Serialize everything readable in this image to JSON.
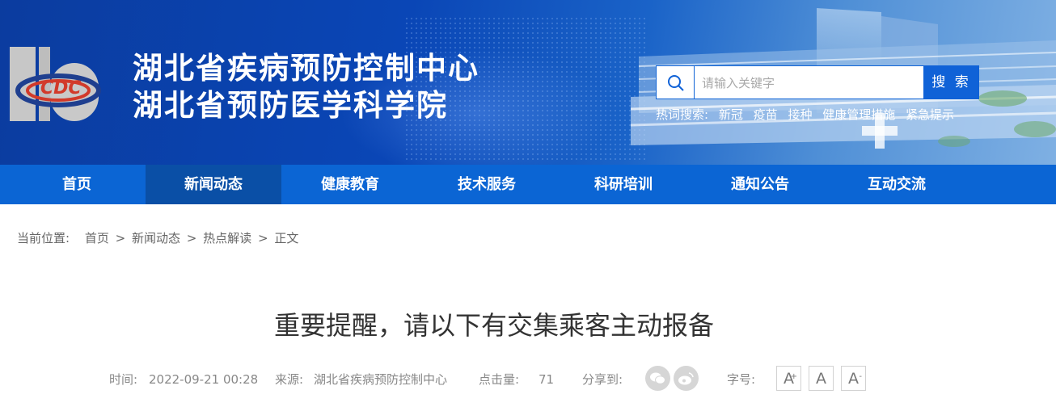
{
  "header": {
    "title_line1": "湖北省疾病预防控制中心",
    "title_line2": "湖北省预防医学科学院"
  },
  "search": {
    "placeholder": "请输入关键字",
    "button_label": "搜 索"
  },
  "hot_search": {
    "label": "热词搜索:",
    "terms": [
      "新冠",
      "疫苗",
      "接种",
      "健康管理措施",
      "紧急提示"
    ]
  },
  "nav": {
    "items": [
      "首页",
      "新闻动态",
      "健康教育",
      "技术服务",
      "科研培训",
      "通知公告",
      "互动交流"
    ],
    "active": "新闻动态"
  },
  "breadcrumb": {
    "label": "当前位置:",
    "items": [
      "首页",
      "新闻动态",
      "热点解读",
      "正文"
    ],
    "separator": ">"
  },
  "article": {
    "title": "重要提醒，请以下有交集乘客主动报备",
    "time_label": "时间:",
    "time": "2022-09-21 00:28",
    "source_label": "来源:",
    "source": "湖北省疾病预防控制中心",
    "clicks_label": "点击量:",
    "clicks": "71",
    "share_label": "分享到:",
    "font_label": "字号:",
    "font_buttons": [
      "A",
      "A",
      "A"
    ]
  },
  "colors": {
    "nav_bg": "#0b65d4",
    "nav_active": "#0a4fa6",
    "search_button": "#1062d7"
  }
}
